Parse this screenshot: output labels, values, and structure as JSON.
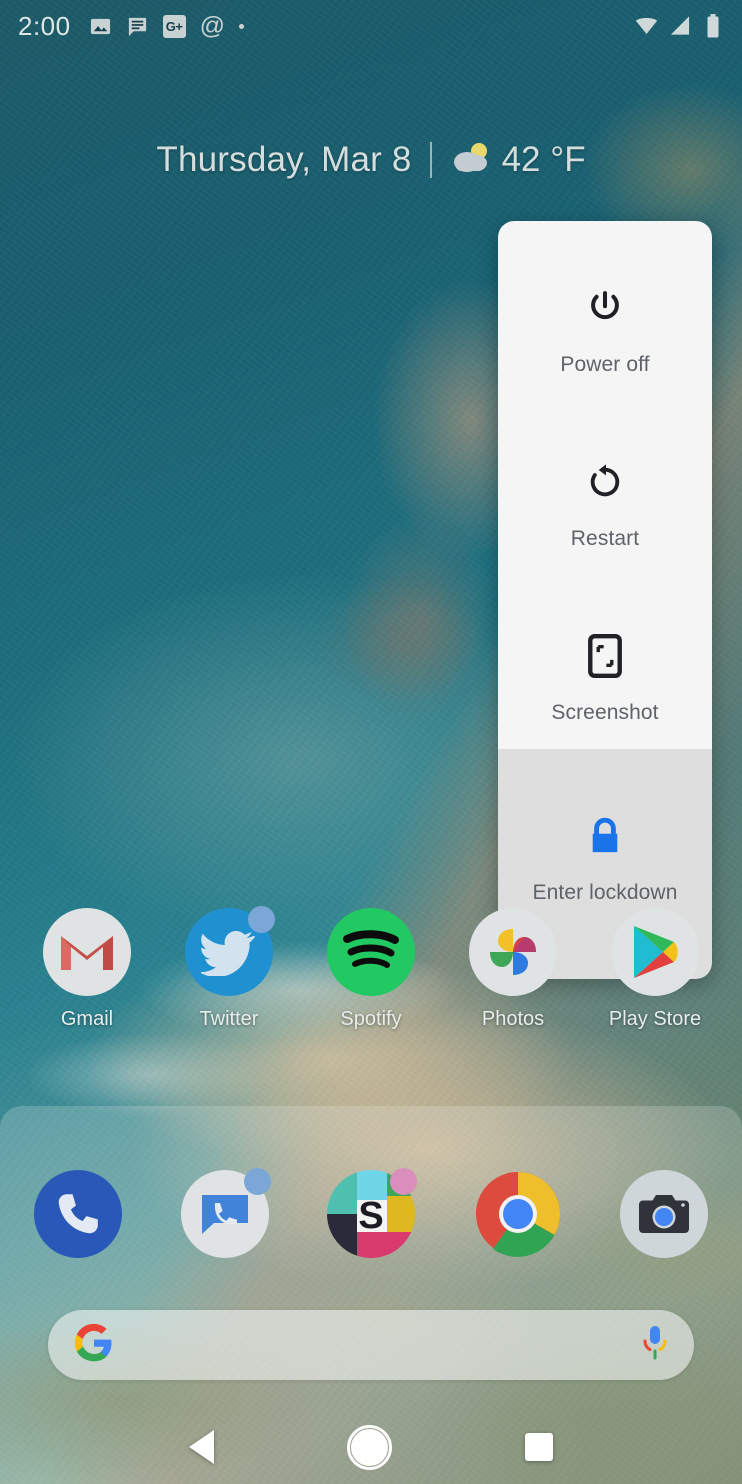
{
  "statusbar": {
    "time": "2:00",
    "left_icons": [
      {
        "name": "photos-notification-icon",
        "glyph": "image"
      },
      {
        "name": "messages-notification-icon",
        "glyph": "message"
      },
      {
        "name": "google-plus-notification-icon",
        "glyph": "G+",
        "label": "G+"
      },
      {
        "name": "email-notification-icon",
        "glyph": "@",
        "label": "@"
      },
      {
        "name": "more-notifications-dot-icon",
        "glyph": "dot"
      }
    ],
    "right_icons": [
      {
        "name": "wifi-icon",
        "state": "full"
      },
      {
        "name": "cellular-signal-icon",
        "state": "full"
      },
      {
        "name": "battery-icon",
        "state": "full"
      }
    ]
  },
  "date_widget": {
    "date": "Thursday, Mar 8",
    "separator": "|",
    "weather_icon": "partly-cloudy-icon",
    "temperature": "42 °F"
  },
  "power_menu": {
    "primary_items": [
      {
        "id": "power-off",
        "label": "Power off",
        "icon": "power-icon"
      },
      {
        "id": "restart",
        "label": "Restart",
        "icon": "restart-icon"
      },
      {
        "id": "screenshot",
        "label": "Screenshot",
        "icon": "screenshot-icon"
      }
    ],
    "secondary_items": [
      {
        "id": "enter-lockdown",
        "label": "Enter lockdown",
        "icon": "lock-icon",
        "icon_color": "#1a73e8"
      }
    ],
    "background_primary": "#f5f5f5",
    "background_secondary": "#dedede",
    "label_color": "#5f6368"
  },
  "home_apps": [
    {
      "name": "gmail",
      "label": "Gmail",
      "badge": false
    },
    {
      "name": "twitter",
      "label": "Twitter",
      "badge": true
    },
    {
      "name": "spotify",
      "label": "Spotify",
      "badge": false
    },
    {
      "name": "photos",
      "label": "Photos",
      "badge": false
    },
    {
      "name": "play-store",
      "label": "Play Store",
      "badge": false
    }
  ],
  "dock_apps": [
    {
      "name": "phone",
      "label": "Phone",
      "badge": false
    },
    {
      "name": "messages",
      "label": "Messages",
      "badge": true
    },
    {
      "name": "slack",
      "label": "Slack",
      "badge": true
    },
    {
      "name": "chrome",
      "label": "Chrome",
      "badge": false
    },
    {
      "name": "camera",
      "label": "Camera",
      "badge": false
    }
  ],
  "search_bar": {
    "placeholder": "",
    "value": "",
    "left_icon": "google-g-icon",
    "right_icon": "microphone-icon"
  },
  "nav_bar": {
    "back": "back-button",
    "home": "home-button",
    "recents": "recents-button"
  },
  "colors": {
    "accent_blue": "#1a73e8",
    "menu_primary_bg": "#f5f5f5",
    "menu_secondary_bg": "#dedede",
    "status_text": "#dfe6e6"
  }
}
